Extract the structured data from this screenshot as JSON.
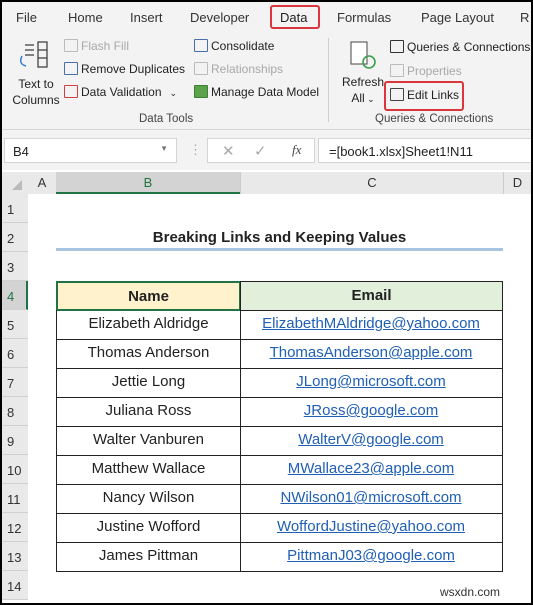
{
  "ribbon_tabs": [
    "File",
    "Home",
    "Insert",
    "Developer",
    "Data",
    "Formulas",
    "Page Layout",
    "R"
  ],
  "active_tab": "Data",
  "data_tools": {
    "text_to_columns": "Text to Columns",
    "flash_fill": "Flash Fill",
    "remove_duplicates": "Remove Duplicates",
    "data_validation": "Data Validation",
    "consolidate": "Consolidate",
    "relationships": "Relationships",
    "manage_data_model": "Manage Data Model",
    "group_label": "Data Tools"
  },
  "queries": {
    "refresh_all_1": "Refresh",
    "refresh_all_2": "All",
    "queries_connections": "Queries & Connections",
    "properties": "Properties",
    "edit_links": "Edit Links",
    "group_label": "Queries & Connections"
  },
  "formula_bar": {
    "name_box": "B4",
    "formula": "=[book1.xlsx]Sheet1!N11"
  },
  "columns": [
    "A",
    "B",
    "C",
    "D"
  ],
  "rows": [
    "1",
    "2",
    "3",
    "4",
    "5",
    "6",
    "7",
    "8",
    "9",
    "10",
    "11",
    "12",
    "13",
    "14"
  ],
  "sheet": {
    "title": "Breaking Links and Keeping Values",
    "headers": [
      "Name",
      "Email"
    ],
    "records": [
      [
        "Elizabeth Aldridge",
        "ElizabethMAldridge@yahoo.com"
      ],
      [
        "Thomas Anderson",
        "ThomasAnderson@apple.com"
      ],
      [
        "Jettie Long",
        "JLong@microsoft.com"
      ],
      [
        "Juliana Ross",
        "JRoss@google.com"
      ],
      [
        "Walter Vanburen",
        "WalterV@google.com"
      ],
      [
        "Matthew Wallace",
        "MWallace23@apple.com"
      ],
      [
        "Nancy Wilson",
        "NWilson01@microsoft.com"
      ],
      [
        "Justine Wofford",
        "WoffordJustine@yahoo.com"
      ],
      [
        "James Pittman",
        "PittmanJ03@google.com"
      ]
    ]
  },
  "watermark": "wsxdn.com",
  "colors": {
    "highlight": "#d9363e",
    "name_header": "#fff2cc",
    "email_header": "#e2efda",
    "link": "#1f5fb4",
    "selection": "#217346"
  }
}
